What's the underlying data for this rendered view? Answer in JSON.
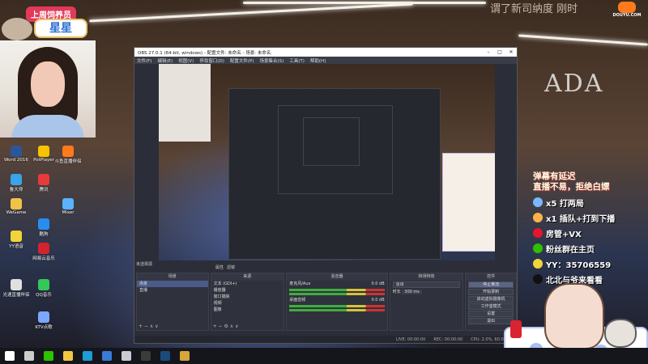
{
  "stream_badge": {
    "tag": "上周饲养员",
    "name": "星星"
  },
  "watermark": {
    "logo_text": "DOUYU.COM",
    "scroll_text": "谓了新司纳度  刚时",
    "brand_wall": "ADA"
  },
  "desktop_icons": [
    {
      "label": "Word 2016",
      "color": "#2b579a"
    },
    {
      "label": "PotPlayer",
      "color": "#f5c400"
    },
    {
      "label": "斗鱼直播伴侣",
      "color": "#ff7a1a"
    },
    {
      "label": "鲁大师",
      "color": "#3ba3e8"
    },
    {
      "label": "腾讯",
      "color": "#e83a3a"
    },
    {
      "label": "WeGame",
      "color": "#f0c24a"
    },
    {
      "label": "Mixer",
      "color": "#5bb3ff"
    },
    {
      "label": "酷狗",
      "color": "#2a8cf0"
    },
    {
      "label": "YY语音",
      "color": "#f2d43a"
    },
    {
      "label": "网易云音乐",
      "color": "#d4232f"
    },
    {
      "label": "光速直播伴侣",
      "color": "#e0e0e0"
    },
    {
      "label": "QQ音乐",
      "color": "#34c759"
    },
    {
      "label": "KTV点歌",
      "color": "#7aa7ff"
    }
  ],
  "overlay_panel": {
    "headline_1": "弹幕有延迟",
    "headline_2": "直播不易，拒绝白嫖",
    "rows": [
      {
        "icon": "bilibili-icon",
        "color": "#7ab8ff",
        "text": "x5 打两局"
      },
      {
        "icon": "fish-icon",
        "color": "#ffb347",
        "text": "x1 插队+打到下播"
      },
      {
        "icon": "weibo-icon",
        "color": "#e6162d",
        "text": "房管+VX"
      },
      {
        "icon": "wechat-icon",
        "color": "#2dc100",
        "text": "粉丝群在主页"
      },
      {
        "icon": "yy-icon",
        "color": "#f2d43a",
        "text": "YY：35706559"
      },
      {
        "icon": "douyin-icon",
        "color": "#111111",
        "text": "北北与爷来看看"
      }
    ]
  },
  "obs": {
    "title": "OBS 27.0.1 (64-bit, windows) - 配置文件: 未命名 - 场景: 未命名",
    "menu": [
      "文件(F)",
      "编辑(E)",
      "视图(V)",
      "停靠窗口(D)",
      "配置文件(P)",
      "场景集合(S)",
      "工具(T)",
      "帮助(H)"
    ],
    "no_source_label": "未选择源",
    "tabs": [
      "属性",
      "滤镜"
    ],
    "docks": {
      "scenes": {
        "title": "场景",
        "items": [
          "场景",
          "直播"
        ]
      },
      "sources": {
        "title": "来源",
        "items": [
          "文本 (GDI+)",
          "播放器",
          "窗口捕获",
          "视频",
          "图像"
        ]
      },
      "mixer": {
        "title": "混音器",
        "tracks": [
          "麦克风/Aux",
          "桌面音频"
        ],
        "levels": [
          "0.0 dB",
          "0.0 dB"
        ]
      },
      "transitions": {
        "title": "转场特效",
        "type": "淡出",
        "duration_label": "时长",
        "duration": "300 ms"
      },
      "controls": {
        "title": "控件",
        "buttons": [
          "停止推流",
          "开始录制",
          "启动虚拟摄像机",
          "工作室模式",
          "设置",
          "退出"
        ]
      }
    },
    "status": {
      "live": "LIVE: 00:00:00",
      "rec": "REC: 00:00:00",
      "cpu": "CPU: 2.0%, 60.00 fps"
    }
  },
  "taskbar": {
    "icons": [
      {
        "name": "windows-start-icon",
        "color": "#ffffff"
      },
      {
        "name": "search-icon",
        "color": "#cccccc"
      },
      {
        "name": "wechat-icon",
        "color": "#2dc100"
      },
      {
        "name": "file-explorer-icon",
        "color": "#f2c744"
      },
      {
        "name": "edge-icon",
        "color": "#1f9bd6"
      },
      {
        "name": "windows-icon",
        "color": "#3a7bd5"
      },
      {
        "name": "app-icon",
        "color": "#c8ccd4"
      },
      {
        "name": "obs-icon",
        "color": "#3b3b3b"
      },
      {
        "name": "steam-icon",
        "color": "#1b4b7a"
      },
      {
        "name": "game-icon",
        "color": "#d4a53a"
      }
    ]
  }
}
